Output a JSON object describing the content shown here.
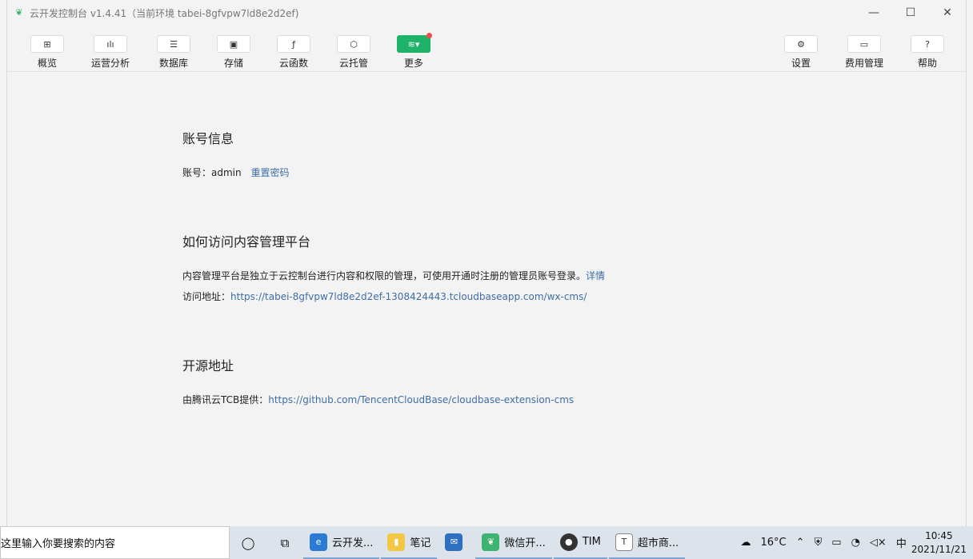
{
  "window": {
    "title": "云开发控制台 v1.4.41（当前环境 tabei-8gfvpw7ld8e2d2ef)",
    "min_icon": "—",
    "max_icon": "☐",
    "close_icon": "✕"
  },
  "toolbar": {
    "items": [
      {
        "label": "概览",
        "icon": "grid-icon",
        "glyph": "⊞"
      },
      {
        "label": "运营分析",
        "icon": "bar-chart-icon",
        "glyph": "ılı"
      },
      {
        "label": "数据库",
        "icon": "database-icon",
        "glyph": "☰"
      },
      {
        "label": "存储",
        "icon": "save-icon",
        "glyph": "▣"
      },
      {
        "label": "云函数",
        "icon": "function-icon",
        "glyph": "ƒ"
      },
      {
        "label": "云托管",
        "icon": "cube-icon",
        "glyph": "⬡"
      },
      {
        "label": "更多",
        "icon": "layers-icon",
        "glyph": "≋▾"
      },
      {
        "label": "设置",
        "icon": "gear-icon",
        "glyph": "⚙"
      },
      {
        "label": "费用管理",
        "icon": "billing-icon",
        "glyph": "▭"
      },
      {
        "label": "帮助",
        "icon": "help-icon",
        "glyph": "?"
      }
    ]
  },
  "account": {
    "title": "账号信息",
    "label": "账号：",
    "value": "admin",
    "reset_link": "重置密码"
  },
  "access": {
    "title": "如何访问内容管理平台",
    "desc": "内容管理平台是独立于云控制台进行内容和权限的管理，可使用开通时注册的管理员账号登录。",
    "detail_link": "详情",
    "url_label": "访问地址：",
    "url": "https://tabei-8gfvpw7ld8e2d2ef-1308424443.tcloudbaseapp.com/wx-cms/"
  },
  "opensource": {
    "title": "开源地址",
    "label": "由腾讯云TCB提供：",
    "url": "https://github.com/TencentCloudBase/cloudbase-extension-cms"
  },
  "taskbar": {
    "search_placeholder": "这里输入你要搜索的内容",
    "apps": [
      {
        "label": "云开发...",
        "color": "#2b7bd6"
      },
      {
        "label": "笔记",
        "color": "#f2c744"
      },
      {
        "label": "",
        "color": "#2f6fc0"
      },
      {
        "label": "微信开...",
        "color": "#3cb371"
      },
      {
        "label": "TIM",
        "color": "#333333"
      },
      {
        "label": "超市商...",
        "color": "#555555"
      }
    ],
    "temperature": "16°C",
    "ime": "中",
    "time": "10:45",
    "date": "2021/11/21"
  }
}
